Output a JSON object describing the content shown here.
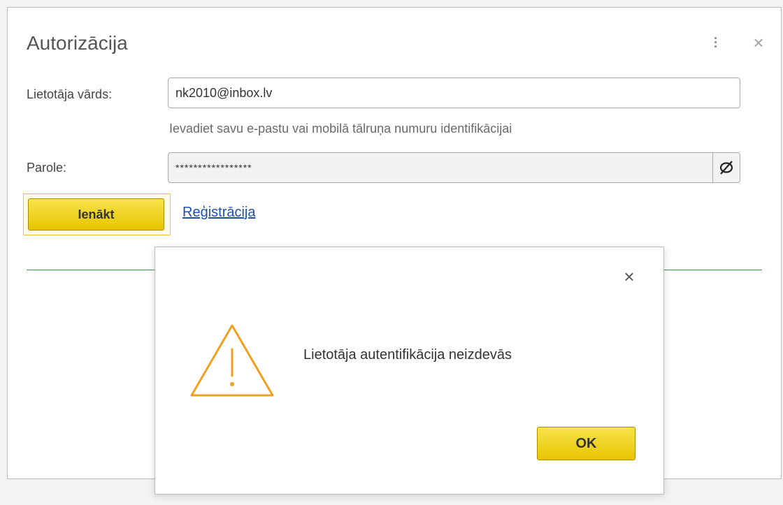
{
  "auth_form": {
    "title": "Autorizācija",
    "username_label": "Lietotāja vārds:",
    "username_value": "nk2010@inbox.lv",
    "username_hint": "Ievadiet savu e-pastu vai mobilā tālruņa numuru identifikācijai",
    "password_label": "Parole:",
    "password_value": "*****************",
    "login_button": "Ienākt",
    "register_link": "Reģistrācija",
    "icons": [
      "more-vert-icon",
      "close-icon",
      "eye-slash-icon"
    ]
  },
  "error_dialog": {
    "message": "Lietotāja autentifikācija neizdevās",
    "ok_button": "OK",
    "icons": [
      "close-icon",
      "warning-icon"
    ]
  },
  "colors": {
    "accent_yellow": "#f0d000",
    "warning_orange": "#f0a020",
    "link_blue": "#1f4fae",
    "divider_green": "#3a9a4a"
  }
}
